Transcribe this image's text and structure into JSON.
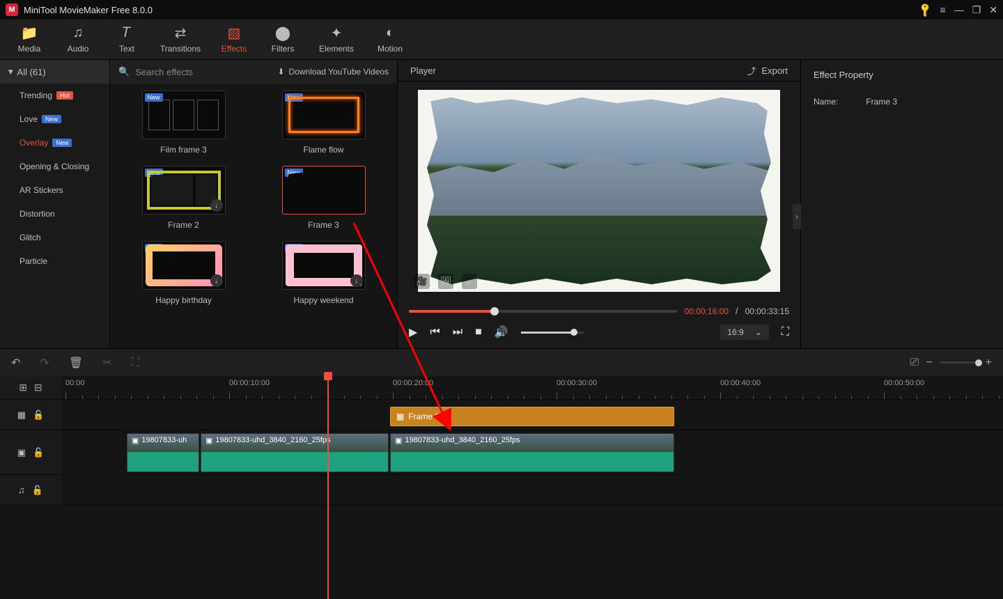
{
  "titlebar": {
    "title": "MiniTool MovieMaker Free 8.0.0"
  },
  "toolbar": {
    "tabs": [
      {
        "label": "Media"
      },
      {
        "label": "Audio"
      },
      {
        "label": "Text"
      },
      {
        "label": "Transitions"
      },
      {
        "label": "Effects"
      },
      {
        "label": "Filters"
      },
      {
        "label": "Elements"
      },
      {
        "label": "Motion"
      }
    ]
  },
  "categories": {
    "header": "All (61)",
    "items": [
      {
        "label": "Trending",
        "badge": "Hot",
        "badgeClass": "hot"
      },
      {
        "label": "Love",
        "badge": "New",
        "badgeClass": "new"
      },
      {
        "label": "Overlay",
        "badge": "New",
        "badgeClass": "new",
        "active": true
      },
      {
        "label": "Opening & Closing"
      },
      {
        "label": "AR Stickers"
      },
      {
        "label": "Distortion"
      },
      {
        "label": "Glitch"
      },
      {
        "label": "Particle"
      }
    ]
  },
  "browse": {
    "search_placeholder": "Search effects",
    "download_link": "Download YouTube Videos"
  },
  "effects": [
    {
      "label": "Film frame 3"
    },
    {
      "label": "Flame flow"
    },
    {
      "label": "Frame 2"
    },
    {
      "label": "Frame 3"
    },
    {
      "label": "Happy birthday"
    },
    {
      "label": "Happy weekend"
    }
  ],
  "player": {
    "title": "Player",
    "export": "Export",
    "time_current": "00:00:16:00",
    "time_total": "00:00:33:15",
    "aspect": "16:9"
  },
  "effect_property": {
    "title": "Effect Property",
    "name_label": "Name:",
    "name_value": "Frame 3"
  },
  "timeline": {
    "ruler": [
      "00:00",
      "00:00:10:00",
      "00:00:20:00",
      "00:00:30:00",
      "00:00:40:00",
      "00:00:50:00"
    ],
    "overlay_clip": "Frame 3",
    "clips": [
      {
        "label": "19807833-uh"
      },
      {
        "label": "19807833-uhd_3840_2160_25fps"
      },
      {
        "label": "19807833-uhd_3840_2160_25fps"
      }
    ]
  }
}
